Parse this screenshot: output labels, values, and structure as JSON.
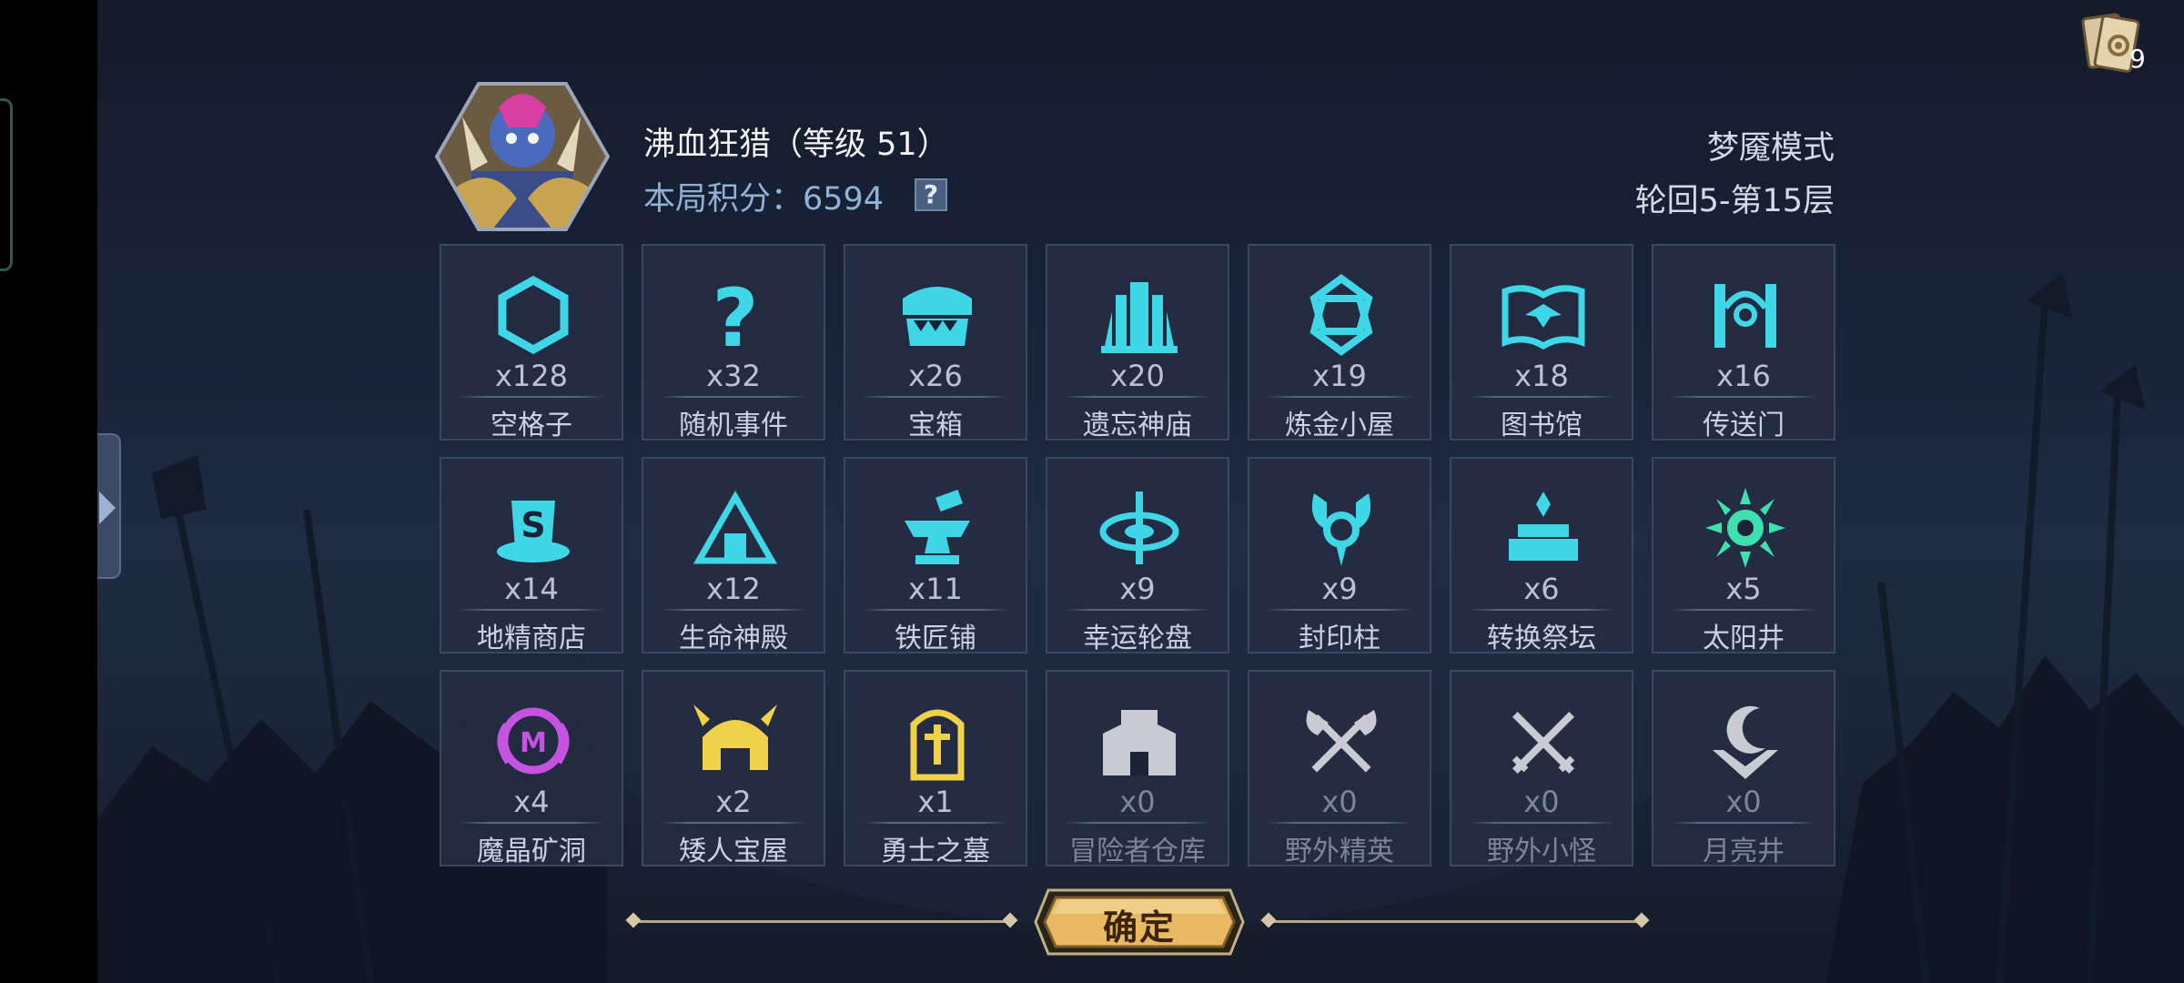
{
  "header": {
    "hero_name": "沸血狂猎（等级 51）",
    "score_label": "本局积分：6594",
    "help_glyph": "?",
    "mode": "梦魇模式",
    "level": "轮回5-第15层"
  },
  "deck": {
    "count": "9",
    "icon": "card-deck-icon"
  },
  "tiles": [
    {
      "count": "x128",
      "name": "空格子",
      "icon": "hexagon-icon",
      "color": "#3fd6e8"
    },
    {
      "count": "x32",
      "name": "随机事件",
      "icon": "question-icon",
      "color": "#3fd6e8"
    },
    {
      "count": "x26",
      "name": "宝箱",
      "icon": "chest-icon",
      "color": "#3fd6e8"
    },
    {
      "count": "x20",
      "name": "遗忘神庙",
      "icon": "temple-icon",
      "color": "#3fd6e8"
    },
    {
      "count": "x19",
      "name": "炼金小屋",
      "icon": "alchemy-icon",
      "color": "#3fd6e8"
    },
    {
      "count": "x18",
      "name": "图书馆",
      "icon": "book-icon",
      "color": "#3fd6e8"
    },
    {
      "count": "x16",
      "name": "传送门",
      "icon": "portal-icon",
      "color": "#3fd6e8"
    },
    {
      "count": "x14",
      "name": "地精商店",
      "icon": "goblin-shop-icon",
      "color": "#3fd6e8"
    },
    {
      "count": "x12",
      "name": "生命神殿",
      "icon": "life-shrine-icon",
      "color": "#3fd6e8"
    },
    {
      "count": "x11",
      "name": "铁匠铺",
      "icon": "anvil-icon",
      "color": "#3fd6e8"
    },
    {
      "count": "x9",
      "name": "幸运轮盘",
      "icon": "wheel-icon",
      "color": "#3fd6e8"
    },
    {
      "count": "x9",
      "name": "封印柱",
      "icon": "seal-pillar-icon",
      "color": "#3fd6e8"
    },
    {
      "count": "x6",
      "name": "转换祭坛",
      "icon": "altar-icon",
      "color": "#3fd6e8"
    },
    {
      "count": "x5",
      "name": "太阳井",
      "icon": "sun-well-icon",
      "color": "#3fe0b0"
    },
    {
      "count": "x4",
      "name": "魔晶矿洞",
      "icon": "crystal-mine-icon",
      "color": "#c552e0"
    },
    {
      "count": "x2",
      "name": "矮人宝屋",
      "icon": "dwarf-helmet-icon",
      "color": "#f0d24a"
    },
    {
      "count": "x1",
      "name": "勇士之墓",
      "icon": "tomb-icon",
      "color": "#f0d24a"
    },
    {
      "count": "x0",
      "name": "冒险者仓库",
      "icon": "warehouse-icon",
      "color": "#c8ccd2"
    },
    {
      "count": "x0",
      "name": "野外精英",
      "icon": "crossed-axes-icon",
      "color": "#c8ccd2"
    },
    {
      "count": "x0",
      "name": "野外小怪",
      "icon": "crossed-swords-icon",
      "color": "#c8ccd2"
    },
    {
      "count": "x0",
      "name": "月亮井",
      "icon": "moon-well-icon",
      "color": "#c8ccd2"
    }
  ],
  "confirm": {
    "label": "确定"
  }
}
